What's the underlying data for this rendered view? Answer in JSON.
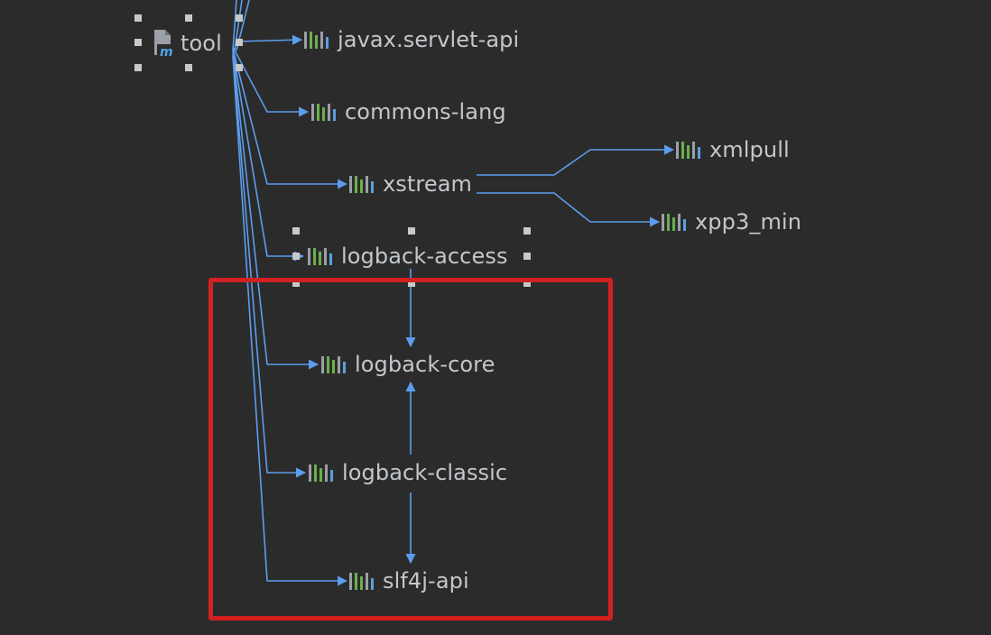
{
  "root": {
    "label": "tool",
    "icon": "maven-module-icon"
  },
  "nodes": [
    {
      "key": "javax_servlet_api",
      "label": "javax.servlet-api",
      "icon": "library-icon"
    },
    {
      "key": "commons_lang",
      "label": "commons-lang",
      "icon": "library-icon"
    },
    {
      "key": "xstream",
      "label": "xstream",
      "icon": "library-icon"
    },
    {
      "key": "xmlpull",
      "label": "xmlpull",
      "icon": "library-icon"
    },
    {
      "key": "xpp3_min",
      "label": "xpp3_min",
      "icon": "library-icon"
    },
    {
      "key": "logback_access",
      "label": "logback-access",
      "icon": "library-icon"
    },
    {
      "key": "logback_core",
      "label": "logback-core",
      "icon": "library-icon"
    },
    {
      "key": "logback_classic",
      "label": "logback-classic",
      "icon": "library-icon"
    },
    {
      "key": "slf4j_api",
      "label": "slf4j-api",
      "icon": "library-icon"
    }
  ],
  "edges": [
    {
      "from": "tool",
      "to": "javax.servlet-api"
    },
    {
      "from": "tool",
      "to": "commons-lang"
    },
    {
      "from": "tool",
      "to": "xstream"
    },
    {
      "from": "tool",
      "to": "logback-access"
    },
    {
      "from": "tool",
      "to": "logback-core"
    },
    {
      "from": "tool",
      "to": "logback-classic"
    },
    {
      "from": "tool",
      "to": "slf4j-api"
    },
    {
      "from": "xstream",
      "to": "xmlpull"
    },
    {
      "from": "xstream",
      "to": "xpp3_min"
    },
    {
      "from": "logback-access",
      "to": "logback-core"
    },
    {
      "from": "logback-classic",
      "to": "logback-core"
    },
    {
      "from": "logback-classic",
      "to": "slf4j-api"
    }
  ],
  "colors": {
    "background": "#2b2b2b",
    "edge": "#5c9ded",
    "label": "#c3c7cb",
    "highlight": "#d32020",
    "handle": "#c8c8c8",
    "icon_green": "#6ab04c",
    "icon_gray": "#9aa0a6",
    "icon_blue": "#5aa0e0"
  }
}
